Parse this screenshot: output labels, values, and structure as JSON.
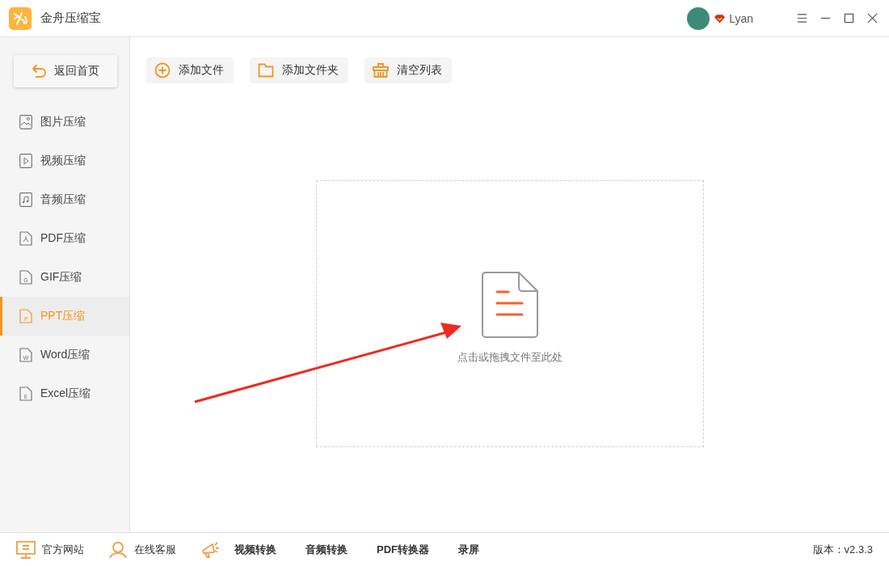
{
  "window": {
    "title": "金舟压缩宝",
    "user": "Lyan"
  },
  "sidebar": {
    "back_button": "返回首页",
    "items": [
      {
        "label": "图片压缩",
        "kind": "image",
        "selected": false
      },
      {
        "label": "视频压缩",
        "kind": "video",
        "selected": false
      },
      {
        "label": "音频压缩",
        "kind": "audio",
        "selected": false
      },
      {
        "label": "PDF压缩",
        "kind": "pdf",
        "selected": false
      },
      {
        "label": "GIF压缩",
        "kind": "gif",
        "icon_text": "G",
        "selected": false
      },
      {
        "label": "PPT压缩",
        "kind": "ppt",
        "icon_text": "P",
        "selected": true
      },
      {
        "label": "Word压缩",
        "kind": "word",
        "icon_text": "W",
        "selected": false
      },
      {
        "label": "Excel压缩",
        "kind": "excel",
        "icon_text": "E",
        "selected": false
      }
    ]
  },
  "toolbar": [
    {
      "label": "添加文件",
      "kind": "add"
    },
    {
      "label": "添加文件夹",
      "kind": "folder"
    },
    {
      "label": "清空列表",
      "kind": "clear"
    }
  ],
  "drop_zone": {
    "hint": "点击或拖拽文件至此处"
  },
  "status_bar": {
    "links": [
      {
        "label": "官方网站",
        "kind": "monitor"
      },
      {
        "label": "在线客服",
        "kind": "support"
      }
    ],
    "tools": [
      "视频转换",
      "音频转换",
      "PDF转换器",
      "录屏"
    ],
    "version": "版本：v2.3.3"
  }
}
